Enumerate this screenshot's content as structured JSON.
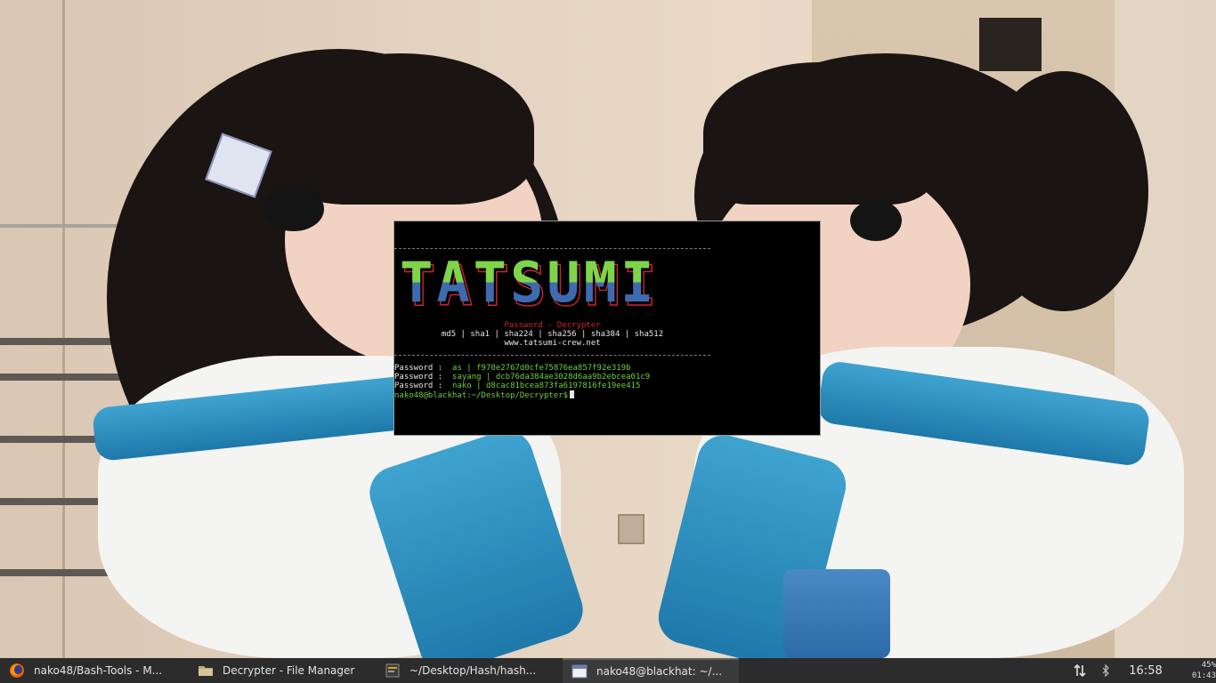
{
  "terminal": {
    "subtitle": "Password - Decrypter",
    "algorithms": "md5 | sha1 | sha224 | sha256 | sha384 | sha512",
    "website": "www.tatsumi-crew.net",
    "banner_text": "TATSUMI",
    "results": [
      {
        "label": "Password :",
        "plain": "as",
        "sep": "|",
        "hash": "f970e2767d0cfe75876ea857f92e319b"
      },
      {
        "label": "Password :",
        "plain": "sayang",
        "sep": "|",
        "hash": "dcb76da384ae3028d6aa9b2ebcea01c9"
      },
      {
        "label": "Password :",
        "plain": "nako",
        "sep": "|",
        "hash": "d8cac81bcea873fa6197816fe19ee415"
      }
    ],
    "prompt": "nako48@blackhat:~/Desktop/Decrypter$",
    "colors": {
      "green": "#6fcf3b",
      "blue": "#3e6bb0",
      "red": "#d0242b"
    }
  },
  "taskbar": {
    "tasks": [
      {
        "label": "nako48/Bash-Tools - M...",
        "icon": "firefox-icon"
      },
      {
        "label": "Decrypter - File Manager",
        "icon": "folder-icon"
      },
      {
        "label": "~/Desktop/Hash/hash...",
        "icon": "text-editor-icon"
      },
      {
        "label": "nako48@blackhat: ~/...",
        "icon": "terminal-icon"
      }
    ],
    "time": "16:58",
    "battery": "45%",
    "battery_time": "01:43"
  }
}
